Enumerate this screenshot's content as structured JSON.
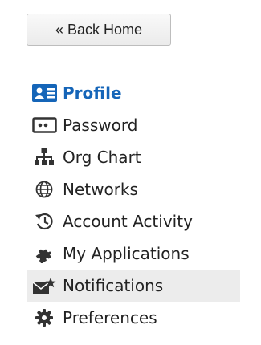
{
  "back_button": {
    "label": "« Back Home"
  },
  "nav": {
    "items": [
      {
        "label": "Profile",
        "icon": "profile-card-icon",
        "active": true
      },
      {
        "label": "Password",
        "icon": "password-icon"
      },
      {
        "label": "Org Chart",
        "icon": "org-chart-icon"
      },
      {
        "label": "Networks",
        "icon": "globe-icon"
      },
      {
        "label": "Account Activity",
        "icon": "history-icon"
      },
      {
        "label": "My Applications",
        "icon": "puzzle-icon"
      },
      {
        "label": "Notifications",
        "icon": "envelope-star-icon",
        "highlighted": true
      },
      {
        "label": "Preferences",
        "icon": "gear-icon"
      }
    ]
  },
  "colors": {
    "accent": "#1565b8",
    "icon": "#333333",
    "highlight_bg": "#ececec"
  }
}
